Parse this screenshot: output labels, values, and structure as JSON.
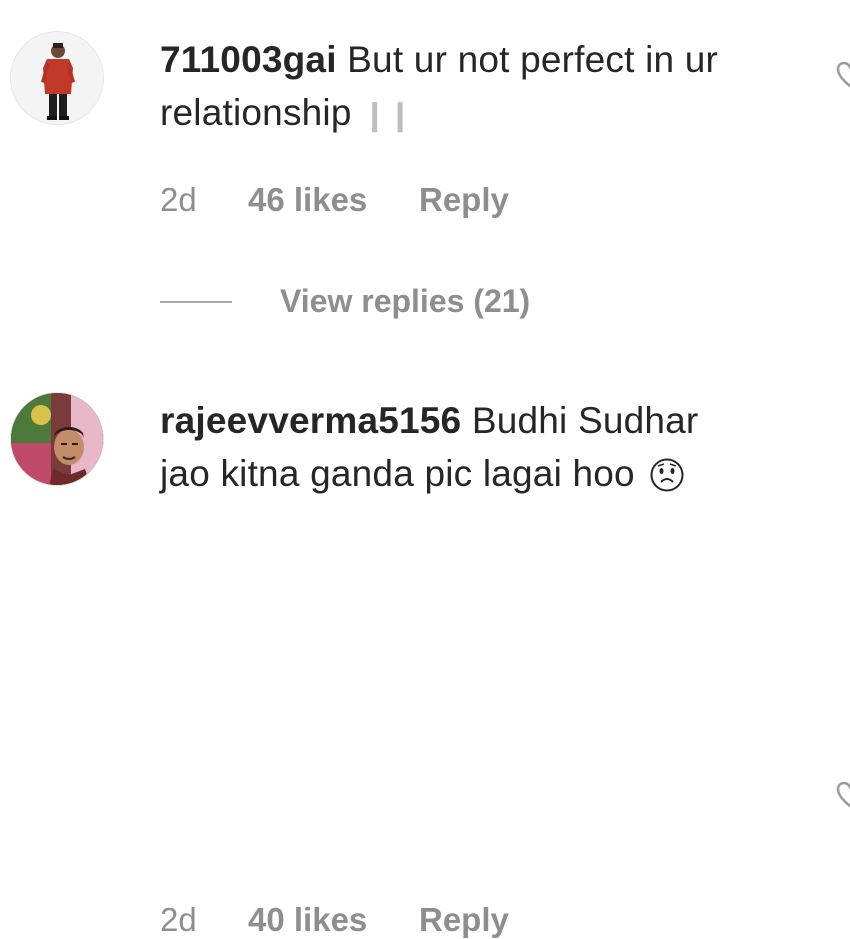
{
  "comments": [
    {
      "username": "711003gai",
      "text_line1": "But ur not perfect in ur",
      "text_line2": "relationship",
      "trailing_emoji": "❙❙",
      "time": "2d",
      "likes": "46 likes",
      "reply_label": "Reply",
      "view_replies": "View replies (21)"
    },
    {
      "username": "rajeevverma5156",
      "text_line1": "Budhi Sudhar",
      "text_line2": "jao kitna ganda pic lagai hoo",
      "time": "2d",
      "likes": "40 likes",
      "reply_label": "Reply"
    }
  ],
  "colors": {
    "username": "#262626",
    "meta": "#8e8e8e",
    "avatar1_shirt": "#c0392b",
    "avatar2_bg": "#7a3c3a"
  },
  "icons": {
    "avatar_1": "person-in-red-kurta",
    "avatar_2": "man-selfie-photo",
    "emoji": "worried-face-icon",
    "like": "heart-outline-icon"
  }
}
